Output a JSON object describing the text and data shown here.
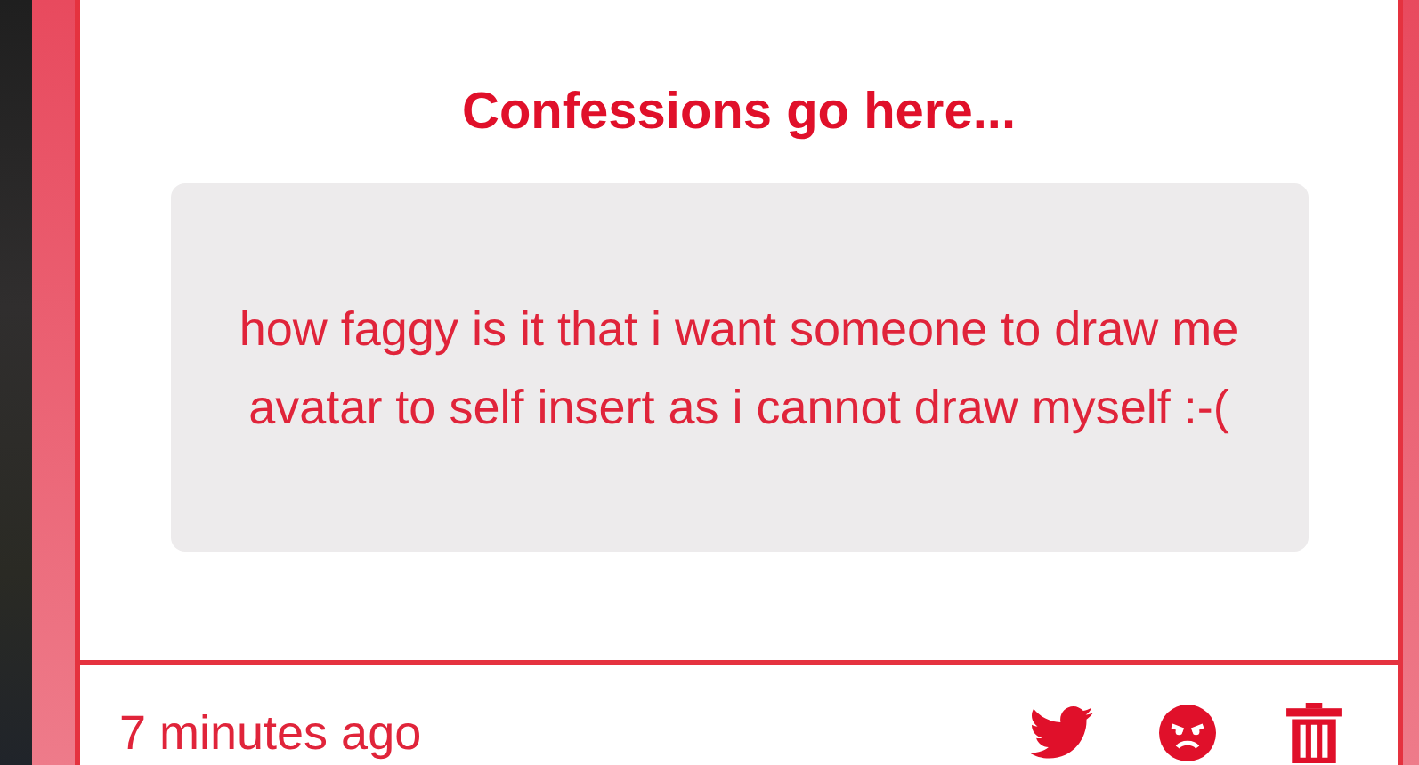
{
  "card": {
    "title": "Confessions go here...",
    "confession": "how faggy is it that i want someone to draw me avatar to self insert as i cannot draw myself :-(",
    "footer": {
      "time": "7 minutes ago",
      "actions": [
        {
          "kind": "share"
        },
        {
          "kind": "report"
        },
        {
          "kind": "delete"
        }
      ]
    }
  }
}
